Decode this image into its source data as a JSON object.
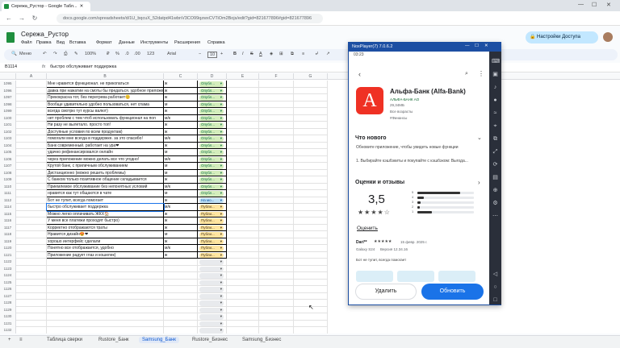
{
  "browser": {
    "tab_title": "Сережа_Рустор - Google Табл...",
    "url": "docs.google.com/spreadsheets/d/1U_bqcuX_52datpd41wbnV3CO99qzwxCVTiOm2Bojs/edit?gid=821677896#gid=821677896"
  },
  "doc": {
    "title": "Сережа_Рустор",
    "menus": [
      "Файл",
      "Правка",
      "Вид",
      "Вставка",
      "Формат",
      "Данные",
      "Инструменты",
      "Расширения",
      "Справка"
    ],
    "share_label": "Настройки Доступа"
  },
  "toolbar": {
    "search": "Меню",
    "zoom": "100%",
    "currency": "₽",
    "percent": "%",
    "dec1": ".0",
    "dec2": ".00",
    "format": "123",
    "font": "Arial",
    "size": "10"
  },
  "formula": {
    "namebox": "B1114",
    "fx": "fx",
    "value": "быстро обслуживает поддержка"
  },
  "columns": [
    "A",
    "B",
    "C",
    "D",
    "E",
    "F",
    "G"
  ],
  "rows": [
    {
      "n": "1095",
      "b": "Мне нравится функционал. не прикопаться",
      "c": "ж",
      "d": "Опубл...",
      "s": "g"
    },
    {
      "n": "1096",
      "b": "давка при нажатии на смоты бы предаться. удобное приложение",
      "c": "ж",
      "d": "Опубл...",
      "s": "g"
    },
    {
      "n": "1097",
      "b": "Прекокрасна тот, без перегрева работает😊",
      "c": "ж",
      "d": "Опубл...",
      "s": "g"
    },
    {
      "n": "1098",
      "b": "Вообще удивительно удобно пользоваться, нет спама",
      "c": "м",
      "d": "Опубл...",
      "s": "g"
    },
    {
      "n": "1099",
      "b": "всегда смотрю тут курсы валют)",
      "c": "ж",
      "d": "Опубл...",
      "s": "g"
    },
    {
      "n": "1100",
      "b": "нет проблем с тем чтоб использовать функционал на поп",
      "c": "м/к",
      "d": "Опубл...",
      "s": "g"
    },
    {
      "n": "1101",
      "b": "Ни разу не вылетало. просто топ!",
      "c": "ж",
      "d": "Опубл...",
      "s": "g"
    },
    {
      "n": "1102",
      "b": "Доступные условия по всем продуктам)",
      "c": "ж",
      "d": "Опубл...",
      "s": "g"
    },
    {
      "n": "1103",
      "b": "помогали мне всегда в поддержке. за это спасибо!",
      "c": "м/к",
      "d": "Опубл...",
      "s": "g"
    },
    {
      "n": "1104",
      "b": "Банк современный. работает на ура❤",
      "c": "ж",
      "d": "Опубл...",
      "s": "g"
    },
    {
      "n": "1105",
      "b": "удачно рефинансировался онлайн",
      "c": "м",
      "d": "Опубл...",
      "s": "g"
    },
    {
      "n": "1106",
      "b": "через приложение можно делать все что угодно!",
      "c": "м/к",
      "d": "Опубл...",
      "s": "g"
    },
    {
      "n": "1107",
      "b": "Крутой банк, с приличным обслуживанием",
      "c": "м",
      "d": "Опубл...",
      "s": "g"
    },
    {
      "n": "1108",
      "b": "Дистанционно (можно решить проблемы)",
      "c": "м",
      "d": "Опубл...",
      "s": "g"
    },
    {
      "n": "1109",
      "b": "С банком только позитивное общение складывается",
      "c": "ж",
      "d": "Опубл...",
      "s": "g"
    },
    {
      "n": "1110",
      "b": "Приемлемое обслуживание без непонятных условий",
      "c": "м/к",
      "d": "Опубл...",
      "s": "g"
    },
    {
      "n": "1111",
      "b": "нравится как тут общаются в чате",
      "c": "м",
      "d": "Опубл...",
      "s": "g"
    },
    {
      "n": "1112",
      "b": "Бот не тупит, всегда помогает",
      "c": "ж",
      "d": "На мо...",
      "s": "b"
    },
    {
      "n": "1114",
      "b": "быстро обслуживает поддержка",
      "c": "м/к",
      "d": "Публи...",
      "s": "y"
    },
    {
      "n": "1115",
      "b": "Можно легко оплачивать ЖКХ🏠",
      "c": "ж",
      "d": "Публи...",
      "s": "y"
    },
    {
      "n": "1116",
      "b": "У меня все платежи проходят быстро)",
      "c": "ж",
      "d": "Публи...",
      "s": "y"
    },
    {
      "n": "1117",
      "b": "Корректно отображаются траты",
      "c": "ж",
      "d": "Публи...",
      "s": "y"
    },
    {
      "n": "1118",
      "b": "Нравится дизайн😍❤",
      "c": "м",
      "d": "Публи...",
      "s": "y"
    },
    {
      "n": "1119",
      "b": "хорошо интерфейс сделали",
      "c": "ж",
      "d": "Публи...",
      "s": "y"
    },
    {
      "n": "1120",
      "b": "Понятно все отображается, удобно",
      "c": "м/к",
      "d": "Публи...",
      "s": "y"
    },
    {
      "n": "1121",
      "b": "Приложение радует глаз и кошелек)",
      "c": "ж",
      "d": "Публи...",
      "s": "y"
    },
    {
      "n": "1122",
      "b": "",
      "c": "",
      "d": "",
      "s": "e"
    },
    {
      "n": "1123",
      "b": "",
      "c": "",
      "d": "",
      "s": "e"
    },
    {
      "n": "1124",
      "b": "",
      "c": "",
      "d": "",
      "s": "e"
    },
    {
      "n": "1125",
      "b": "",
      "c": "",
      "d": "",
      "s": "e"
    },
    {
      "n": "1126",
      "b": "",
      "c": "",
      "d": "",
      "s": "e"
    },
    {
      "n": "1127",
      "b": "",
      "c": "",
      "d": "",
      "s": "e"
    },
    {
      "n": "1128",
      "b": "",
      "c": "",
      "d": "",
      "s": "e"
    },
    {
      "n": "1129",
      "b": "",
      "c": "",
      "d": "",
      "s": "e"
    },
    {
      "n": "1130",
      "b": "",
      "c": "",
      "d": "",
      "s": "e"
    },
    {
      "n": "1131",
      "b": "",
      "c": "",
      "d": "",
      "s": "e"
    },
    {
      "n": "1132",
      "b": "",
      "c": "",
      "d": "",
      "s": "e"
    },
    {
      "n": "1133",
      "b": "",
      "c": "",
      "d": "",
      "s": "e"
    },
    {
      "n": "1134",
      "b": "",
      "c": "",
      "d": "",
      "s": "e"
    },
    {
      "n": "1135",
      "b": "",
      "c": "",
      "d": "",
      "s": "e"
    }
  ],
  "sheet_tabs": [
    "Таблица сверки",
    "Rustore_Банк",
    "Samsung_Банк",
    "Rustore_Бизнес",
    "Samsung_Бизнес"
  ],
  "active_tab": 2,
  "nox": {
    "title": "NoxPlayer(7) 7.0.6.2",
    "time": "03:23",
    "app_name": "Альфа-Банк (Alfa-Bank)",
    "developer": "АЛЬФА-БАНК АО",
    "size": "29,34МБ",
    "age": "Все возрасты",
    "category": "#Финансы",
    "logo_letter": "А",
    "whats_new_title": "Что нового",
    "whats_new_text": "Обновите приложение, чтобы увидеть новые функции",
    "whats_new_item": "1. Выбирайте кэшбэкиты и покупайте с кэшбэком: Выгода...",
    "reviews_title": "Оценки и отзывы",
    "score": "3,5",
    "stars": "★★★★☆",
    "rate_label": "Оценить",
    "bars": [
      {
        "label": "5",
        "frac": 0.75
      },
      {
        "label": "4",
        "frac": 0.12
      },
      {
        "label": "3",
        "frac": 0.06
      },
      {
        "label": "2",
        "frac": 0.04
      },
      {
        "label": "1",
        "frac": 0.25
      }
    ],
    "reviewer": "Dari**",
    "review_stars": "★★★★★",
    "review_date": "15 февр. 2025 г.",
    "device": "Galaxy S24",
    "version": "Версия 12.34.16",
    "review_text": "Бот не тупит, всегда помогает",
    "btn_delete": "Удалить",
    "btn_update": "Обновить"
  }
}
